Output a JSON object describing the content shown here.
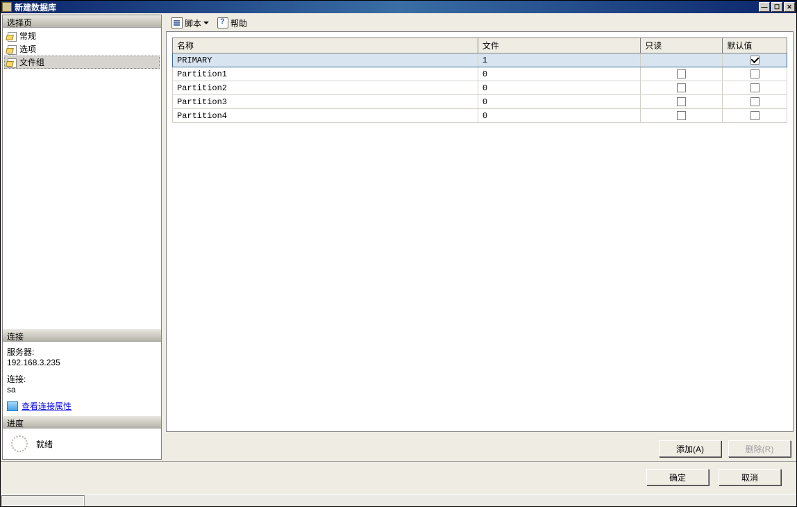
{
  "title": "新建数据库",
  "titlebar": {
    "minimize": "_",
    "maximize": "□",
    "close": "×"
  },
  "left": {
    "select_page_header": "选择页",
    "nav": {
      "general": "常规",
      "options": "选项",
      "filegroups": "文件组"
    },
    "connection_header": "连接",
    "server_label": "服务器:",
    "server_value": "192.168.3.235",
    "conn_label": "连接:",
    "conn_value": "sa",
    "view_props": "查看连接属性",
    "progress_header": "进度",
    "progress_status": "就绪"
  },
  "toolbar": {
    "script": "脚本",
    "help": "帮助"
  },
  "grid": {
    "headers": {
      "name": "名称",
      "files": "文件",
      "readonly": "只读",
      "default": "默认值"
    },
    "rows": [
      {
        "name": "PRIMARY",
        "files": "1",
        "readonly": null,
        "default": true,
        "selected": true
      },
      {
        "name": "Partition1",
        "files": "0",
        "readonly": false,
        "default": false,
        "selected": false
      },
      {
        "name": "Partition2",
        "files": "0",
        "readonly": false,
        "default": false,
        "selected": false
      },
      {
        "name": "Partition3",
        "files": "0",
        "readonly": false,
        "default": false,
        "selected": false
      },
      {
        "name": "Partition4",
        "files": "0",
        "readonly": false,
        "default": false,
        "selected": false
      }
    ]
  },
  "buttons": {
    "add": "添加(A)",
    "remove": "删除(R)",
    "ok": "确定",
    "cancel": "取消"
  }
}
